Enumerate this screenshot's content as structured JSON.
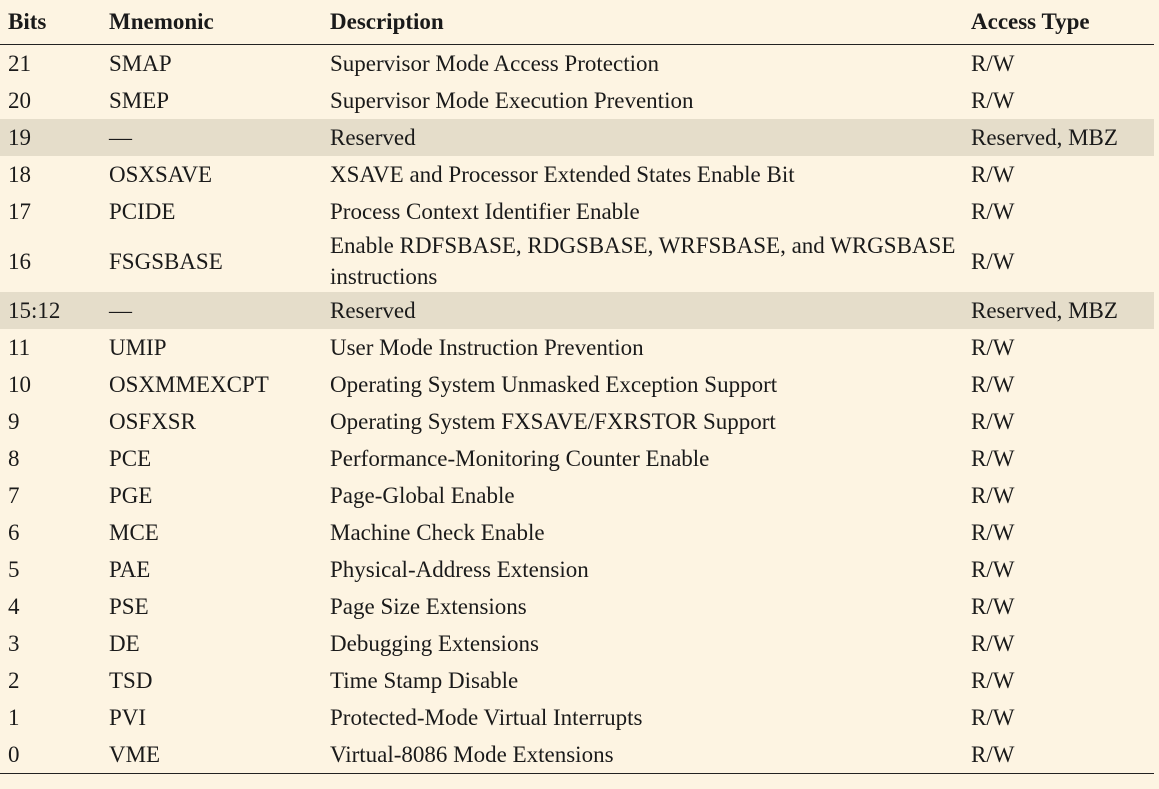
{
  "table": {
    "headers": [
      "Bits",
      "Mnemonic",
      "Description",
      "Access Type"
    ],
    "rows": [
      {
        "bits": "21",
        "mnemonic": "SMAP",
        "description": "Supervisor Mode Access Protection",
        "access": "R/W",
        "reserved": false
      },
      {
        "bits": "20",
        "mnemonic": "SMEP",
        "description": "Supervisor Mode Execution Prevention",
        "access": "R/W",
        "reserved": false
      },
      {
        "bits": "19",
        "mnemonic": "—",
        "description": "Reserved",
        "access": "Reserved, MBZ",
        "reserved": true
      },
      {
        "bits": "18",
        "mnemonic": "OSXSAVE",
        "description": "XSAVE and Processor Extended States Enable Bit",
        "access": "R/W",
        "reserved": false
      },
      {
        "bits": "17",
        "mnemonic": "PCIDE",
        "description": "Process Context Identifier Enable",
        "access": "R/W",
        "reserved": false
      },
      {
        "bits": "16",
        "mnemonic": "FSGSBASE",
        "description": "Enable RDFSBASE, RDGSBASE, WRFSBASE, and WRGSBASE instructions",
        "access": "R/W",
        "reserved": false
      },
      {
        "bits": "15:12",
        "mnemonic": "—",
        "description": "Reserved",
        "access": "Reserved, MBZ",
        "reserved": true
      },
      {
        "bits": "11",
        "mnemonic": "UMIP",
        "description": "User Mode Instruction Prevention",
        "access": "R/W",
        "reserved": false
      },
      {
        "bits": "10",
        "mnemonic": "OSXMMEXCPT",
        "description": "Operating System Unmasked Exception Support",
        "access": "R/W",
        "reserved": false
      },
      {
        "bits": "9",
        "mnemonic": "OSFXSR",
        "description": "Operating System FXSAVE/FXRSTOR Support",
        "access": "R/W",
        "reserved": false
      },
      {
        "bits": "8",
        "mnemonic": "PCE",
        "description": "Performance-Monitoring Counter Enable",
        "access": "R/W",
        "reserved": false
      },
      {
        "bits": "7",
        "mnemonic": "PGE",
        "description": "Page-Global Enable",
        "access": "R/W",
        "reserved": false
      },
      {
        "bits": "6",
        "mnemonic": "MCE",
        "description": "Machine Check Enable",
        "access": "R/W",
        "reserved": false
      },
      {
        "bits": "5",
        "mnemonic": "PAE",
        "description": "Physical-Address Extension",
        "access": "R/W",
        "reserved": false
      },
      {
        "bits": "4",
        "mnemonic": "PSE",
        "description": "Page Size Extensions",
        "access": "R/W",
        "reserved": false
      },
      {
        "bits": "3",
        "mnemonic": "DE",
        "description": "Debugging Extensions",
        "access": "R/W",
        "reserved": false
      },
      {
        "bits": "2",
        "mnemonic": "TSD",
        "description": "Time Stamp Disable",
        "access": "R/W",
        "reserved": false
      },
      {
        "bits": "1",
        "mnemonic": "PVI",
        "description": "Protected-Mode Virtual Interrupts",
        "access": "R/W",
        "reserved": false
      },
      {
        "bits": "0",
        "mnemonic": "VME",
        "description": "Virtual-8086 Mode Extensions",
        "access": "R/W",
        "reserved": false
      }
    ]
  },
  "colors": {
    "background": "#fdf4e2",
    "reserved_row": "#e5ddca",
    "rule": "#222222"
  }
}
